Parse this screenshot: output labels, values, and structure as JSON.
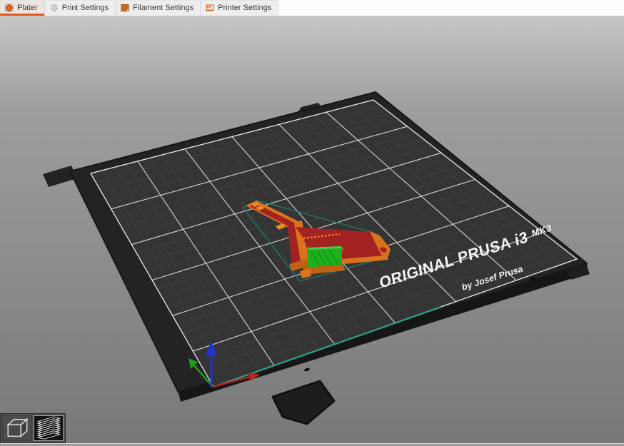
{
  "tabs": [
    {
      "label": "Plater",
      "icon": "plater-icon",
      "selected": true
    },
    {
      "label": "Print Settings",
      "icon": "gear-icon",
      "selected": false
    },
    {
      "label": "Filament Settings",
      "icon": "filament-spool-icon",
      "selected": false
    },
    {
      "label": "Printer Settings",
      "icon": "printer-icon",
      "selected": false
    }
  ],
  "bed": {
    "brand": "ORIGINAL PRUSA i3",
    "model": "MK3",
    "byline": "by Josef Prusa"
  },
  "view_modes": {
    "first": "3d-view",
    "second": "layer-preview-view",
    "active": "layer-preview-view"
  },
  "colors": {
    "accent_orange": "#e2571b",
    "tabbar_line": "#cf8a5f",
    "viewport_top": "#c6c6c6",
    "viewport_mid": "#9e9e9e",
    "viewport_bottom": "#787878",
    "bed_slab": "#232323",
    "bed_slab_dark": "#161616",
    "bed_sheet": "#343434",
    "grid_minor": "#424242",
    "grid_major": "#ededed",
    "bed_edge_teal": "#2fa392",
    "silhouette_teal": "#1e8070",
    "model_orange": "#d9741d",
    "model_orange_dark": "#c06114",
    "model_orange_bright": "#ef8c22",
    "model_red": "#a32323",
    "support_green": "#1db01d",
    "support_green_light": "#43cf43",
    "support_green_dark": "#0f8a0f",
    "axis_x_red": "#bb2222",
    "axis_y_green": "#1e9e1e",
    "axis_z_blue": "#2233cc",
    "bed_text": "#f5f5f5"
  }
}
